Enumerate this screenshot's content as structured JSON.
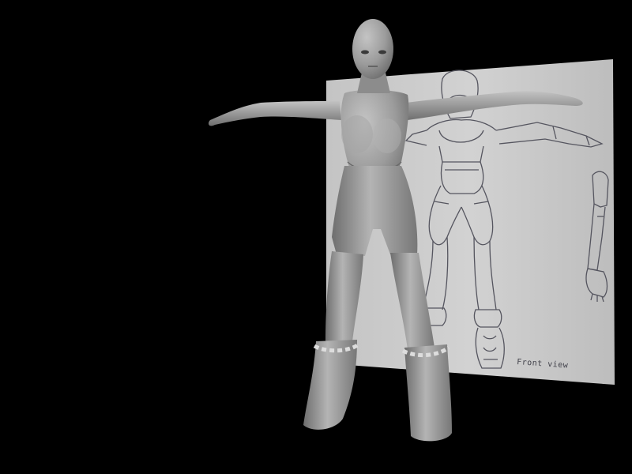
{
  "scene": {
    "background_color": "#000000",
    "reference_sheet": {
      "paper_color": "#cfcfcf",
      "line_color": "#4d4d5a",
      "caption": "Front view"
    },
    "model": {
      "render_style": "grey shaded 3D character in T-pose",
      "base_color": "#9a9a9a"
    }
  }
}
